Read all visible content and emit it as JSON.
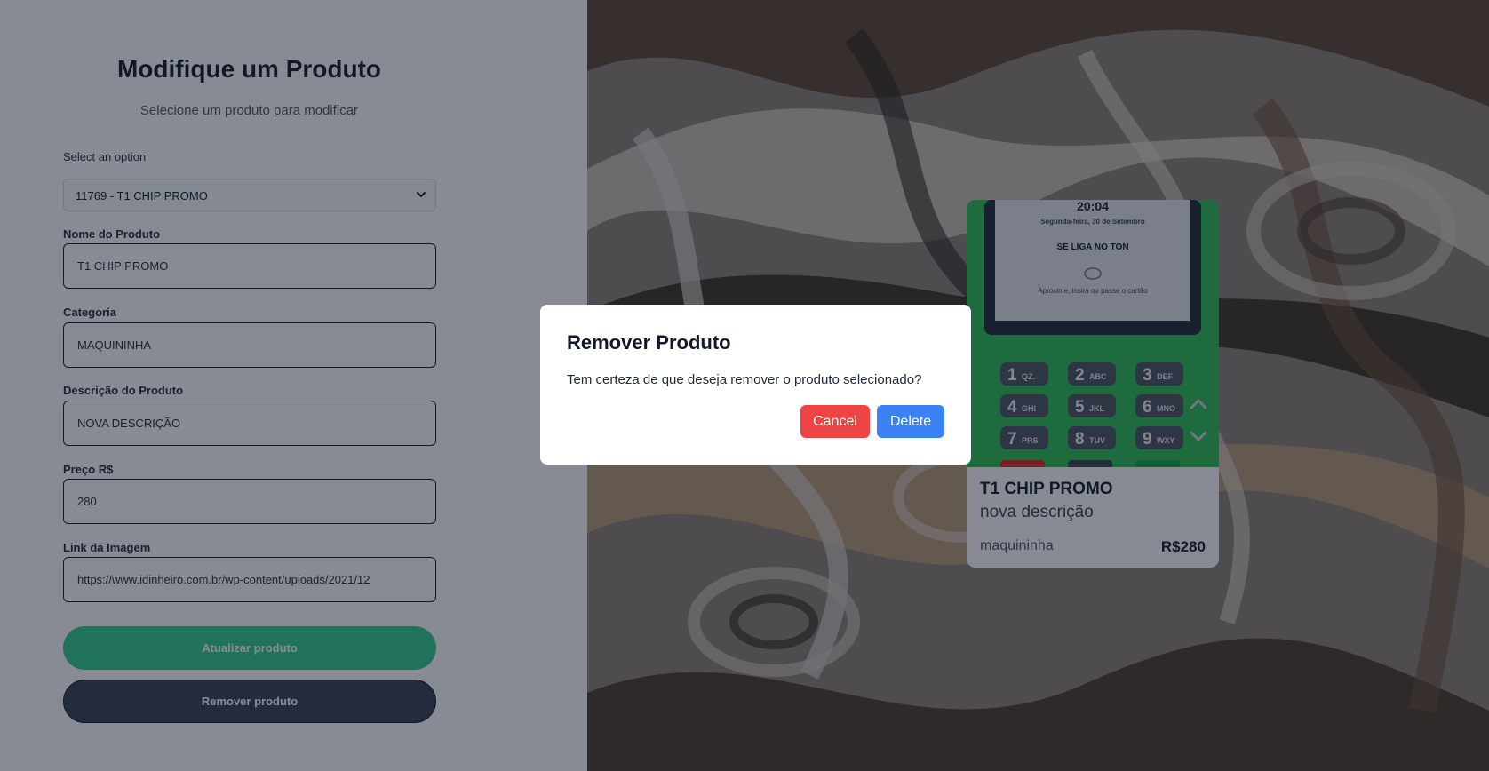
{
  "form": {
    "title": "Modifique um Produto",
    "subtitle": "Selecione um produto para modificar",
    "select_label": "Select an option",
    "select_value": "11769 - T1 CHIP PROMO",
    "fields": [
      {
        "label": "Nome do Produto",
        "value": "T1 CHIP PROMO"
      },
      {
        "label": "Categoria",
        "value": "MAQUININHA"
      },
      {
        "label": "Descrição do Produto",
        "value": "NOVA DESCRIÇÃO"
      },
      {
        "label": "Preço R$",
        "value": "280"
      },
      {
        "label": "Link da Imagem",
        "value": "https://www.idinheiro.com.br/wp-content/uploads/2021/12"
      }
    ],
    "update_button": "Atualizar produto",
    "remove_button": "Remover produto"
  },
  "product_card": {
    "screen_time": "20:04",
    "screen_date": "Segunda-feira, 30 de Setembro",
    "screen_brand": "SE LIGA NO TON",
    "screen_hint": "Aproxime, insira ou passe o cartão",
    "keypad": [
      {
        "digit": "1",
        "letters": "QZ."
      },
      {
        "digit": "2",
        "letters": "ABC"
      },
      {
        "digit": "3",
        "letters": "DEF"
      },
      {
        "digit": "4",
        "letters": "GHI"
      },
      {
        "digit": "5",
        "letters": "JKL"
      },
      {
        "digit": "6",
        "letters": "MNO"
      },
      {
        "digit": "7",
        "letters": "PRS"
      },
      {
        "digit": "8",
        "letters": "TUV"
      },
      {
        "digit": "9",
        "letters": "WXY"
      }
    ],
    "name": "T1 CHIP PROMO",
    "description": "nova descrição",
    "category": "maquininha",
    "price": "R$280",
    "up_icon": "chevron-up-icon",
    "down_icon": "chevron-down-icon"
  },
  "modal": {
    "title": "Remover Produto",
    "message": "Tem certeza de que deseja remover o produto selecionado?",
    "cancel_label": "Cancel",
    "delete_label": "Delete"
  },
  "colors": {
    "primary_green": "#2ecc8f",
    "dark_button": "#374151",
    "cancel_red": "#ef4444",
    "delete_blue": "#3b82f6",
    "terminal_green": "#2bbf55"
  }
}
